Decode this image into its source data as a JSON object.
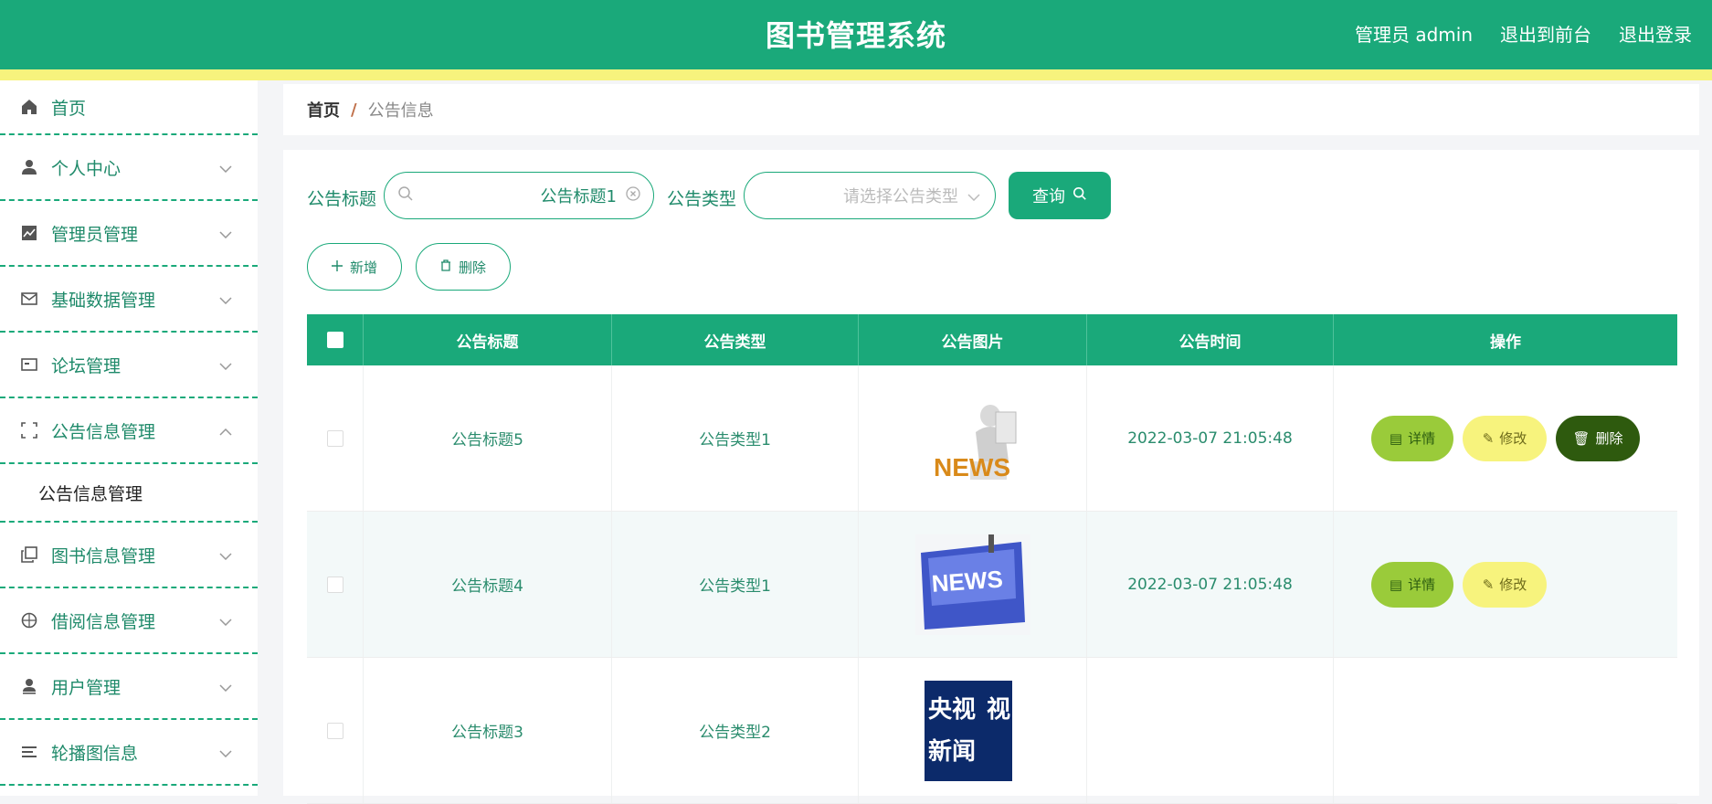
{
  "header": {
    "title": "图书管理系统",
    "links": [
      "管理员 admin",
      "退出到前台",
      "退出登录"
    ]
  },
  "sidebar": {
    "items": [
      {
        "label": "首页",
        "icon": "home-icon"
      },
      {
        "label": "个人中心",
        "icon": "user-icon"
      },
      {
        "label": "管理员管理",
        "icon": "chart-icon"
      },
      {
        "label": "基础数据管理",
        "icon": "mail-icon"
      },
      {
        "label": "论坛管理",
        "icon": "card-icon"
      },
      {
        "label": "公告信息管理",
        "icon": "scan-icon"
      },
      {
        "label": "图书信息管理",
        "icon": "copy-icon"
      },
      {
        "label": "借阅信息管理",
        "icon": "compass-icon"
      },
      {
        "label": "用户管理",
        "icon": "user-icon"
      },
      {
        "label": "轮播图信息",
        "icon": "menu-icon"
      }
    ],
    "sub_item": "公告信息管理"
  },
  "breadcrumb": {
    "home": "首页",
    "separator": "/",
    "current": "公告信息"
  },
  "filters": {
    "title_label": "公告标题",
    "title_value": "公告标题1",
    "type_label": "公告类型",
    "type_placeholder": "请选择公告类型",
    "query_label": "查询"
  },
  "actions": {
    "add_label": "新增",
    "delete_label": "删除"
  },
  "table": {
    "columns": [
      "公告标题",
      "公告类型",
      "公告图片",
      "公告时间",
      "操作"
    ],
    "rows": [
      {
        "title": "公告标题5",
        "type": "公告类型1",
        "image": "news-3d-figure",
        "time": "2022-03-07 21:05:48"
      },
      {
        "title": "公告标题4",
        "type": "公告类型1",
        "image": "news-keyboard-key",
        "time": "2022-03-07 21:05:48"
      },
      {
        "title": "公告标题3",
        "type": "公告类型2",
        "image": "cctv-news-logo",
        "time": ""
      }
    ],
    "op_labels": {
      "detail": "详情",
      "edit": "修改",
      "delete": "删除"
    },
    "image_text": {
      "news": "NEWS",
      "cctv_top": "央视",
      "cctv_bottom": "新闻",
      "cctv_side": "视"
    }
  },
  "colors": {
    "primary": "#1aa97a",
    "stripe": "#f7f37d",
    "detail": "#9acb3a",
    "edit": "#f7f37d",
    "delete": "#2e5a0e"
  }
}
